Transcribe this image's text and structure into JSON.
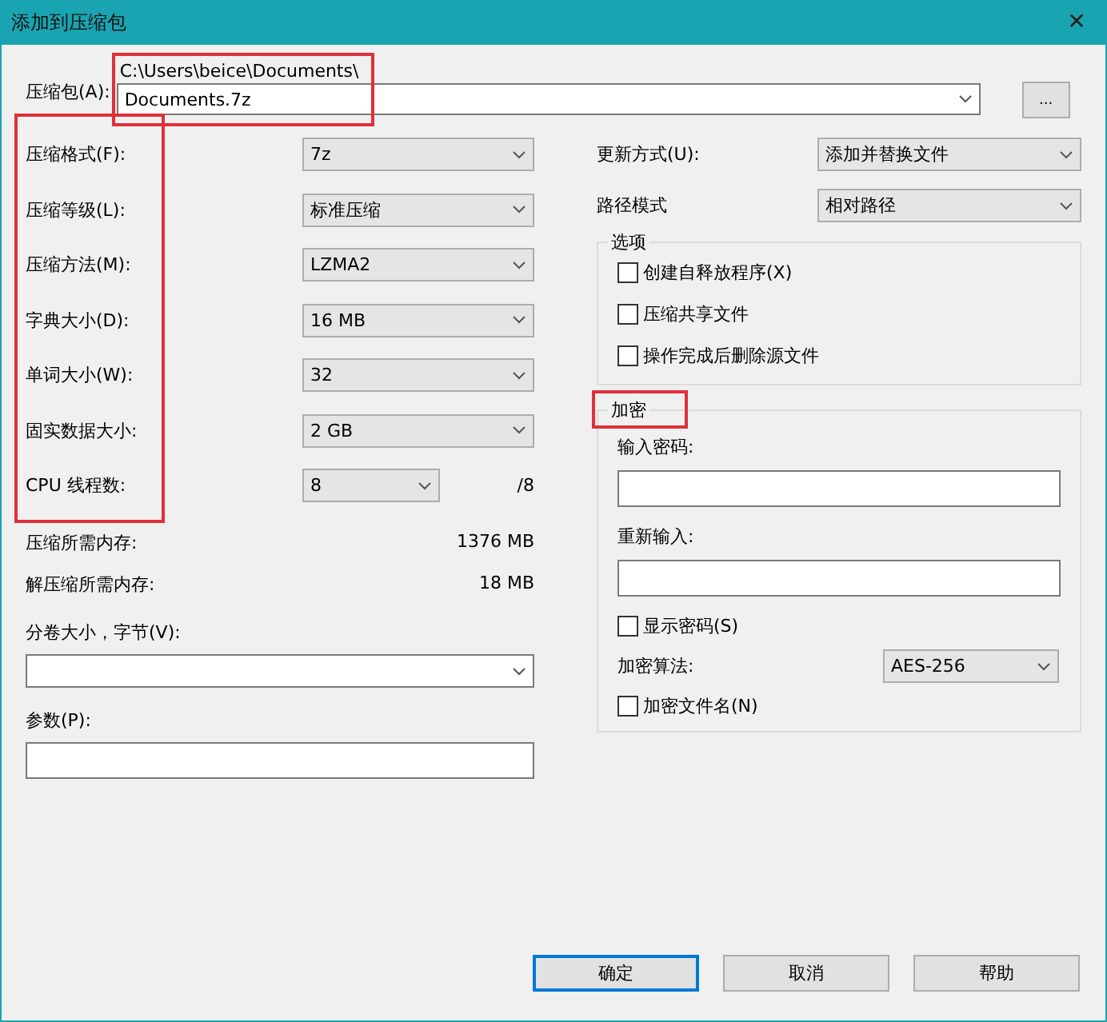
{
  "window": {
    "title": "添加到压缩包",
    "close": "✕"
  },
  "archive": {
    "label": "压缩包(A):",
    "path": "C:\\Users\\beice\\Documents\\",
    "value": "Documents.7z",
    "browse": "...",
    "highlighted": true
  },
  "left_settings": {
    "highlighted": true,
    "rows": [
      {
        "label": "压缩格式(F):",
        "value": "7z",
        "kind": "combo"
      },
      {
        "label": "压缩等级(L):",
        "value": "标准压缩",
        "kind": "combo"
      },
      {
        "label": "压缩方法(M):",
        "value": "LZMA2",
        "kind": "combo"
      },
      {
        "label": "字典大小(D):",
        "value": "16 MB",
        "kind": "combo"
      },
      {
        "label": "单词大小(W):",
        "value": "32",
        "kind": "combo"
      },
      {
        "label": "固实数据大小:",
        "value": "2 GB",
        "kind": "combo"
      },
      {
        "label": "CPU 线程数:",
        "value": "8",
        "kind": "short_combo",
        "suffix": "/8"
      }
    ]
  },
  "memory": [
    {
      "label": "压缩所需内存:",
      "value": "1376 MB"
    },
    {
      "label": "解压缩所需内存:",
      "value": "18 MB"
    }
  ],
  "split": {
    "label": "分卷大小，字节(V):"
  },
  "parameters": {
    "label": "参数(P):"
  },
  "right_settings": [
    {
      "label": "更新方式(U):",
      "value": "添加并替换文件"
    },
    {
      "label": "路径模式",
      "value": "相对路径"
    }
  ],
  "options": {
    "title": "选项",
    "items": [
      {
        "label": "创建自释放程序(X)",
        "checked": false
      },
      {
        "label": "压缩共享文件",
        "checked": false
      },
      {
        "label": "操作完成后删除源文件",
        "checked": false
      }
    ]
  },
  "encryption": {
    "title": "加密",
    "title_highlighted": true,
    "password_label": "输入密码:",
    "reenter_label": "重新输入:",
    "show_password": {
      "label": "显示密码(S)",
      "checked": false
    },
    "method_label": "加密算法:",
    "method": "AES-256",
    "encrypt_names": {
      "label": "加密文件名(N)",
      "checked": false
    }
  },
  "buttons": [
    {
      "label": "确定",
      "default": true
    },
    {
      "label": "取消",
      "default": false
    },
    {
      "label": "帮助",
      "default": false
    }
  ]
}
